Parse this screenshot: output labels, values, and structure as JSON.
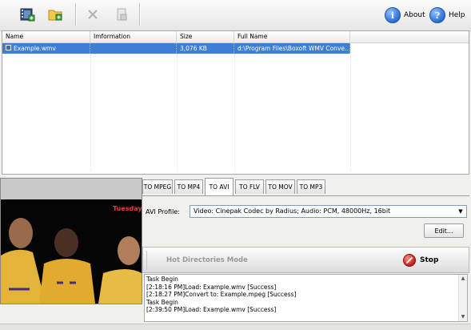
{
  "toolbar": {
    "buttons": [
      {
        "icon": "add-video-icon"
      },
      {
        "icon": "add-folder-icon"
      },
      {
        "icon": "remove-icon"
      },
      {
        "icon": "clear-icon"
      }
    ],
    "about_label": "About",
    "help_label": "Help"
  },
  "file_list": {
    "columns": [
      "Name",
      "Imformation",
      "Size",
      "Full Name"
    ],
    "rows": [
      {
        "name": "Example.wmv",
        "information": "",
        "size": "3,076 KB",
        "full_name": "d:\\Program Files\\Boxoft WMV Conve..."
      }
    ]
  },
  "tabs": [
    "TO MPEG",
    "TO MP4",
    "TO AVI",
    "TO FLV",
    "TO MOV",
    "TO MP3"
  ],
  "active_tab": "TO AVI",
  "avi_panel": {
    "profile_label": "AVI Profile:",
    "profile_value": "Video: Cinepak Codec by Radius; Audio: PCM, 48000Hz, 16bit",
    "edit_label": "Edit..."
  },
  "mode_bar": {
    "hot_directories_label": "Hot Directories Mode",
    "stop_label": "Stop"
  },
  "log": {
    "lines": [
      "Task Begin",
      "[2:18:16 PM]Load: Example.wmv [Success]",
      "[2:18:27 PM]Convert to: Example.mpeg [Success]",
      "Task Begin",
      "[2:39:50 PM]Load: Example.wmv [Success]"
    ]
  },
  "preview": {
    "watermark": "Tuesdays"
  },
  "colors": {
    "selection": "#3c7fd5",
    "stop_red": "#c91d1d",
    "info_blue": "#2a6fcf"
  }
}
